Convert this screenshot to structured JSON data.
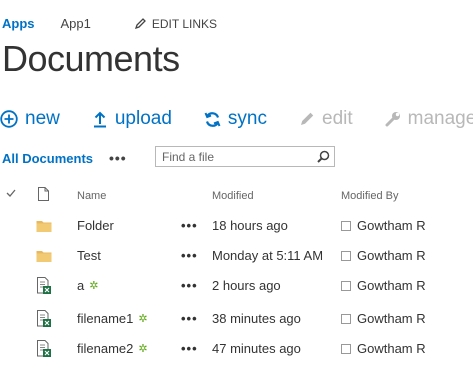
{
  "topnav": {
    "apps": "Apps",
    "app1": "App1",
    "edit_links": "EDIT LINKS"
  },
  "page_title": "Documents",
  "commands": {
    "new": "new",
    "upload": "upload",
    "sync": "sync",
    "edit": "edit",
    "manage": "manage"
  },
  "view": {
    "current_view": "All Documents",
    "more": "•••",
    "search_placeholder": "Find a file"
  },
  "columns": {
    "name": "Name",
    "modified": "Modified",
    "modified_by": "Modified By"
  },
  "rows": [
    {
      "type": "folder",
      "name": "Folder",
      "is_new": false,
      "menu": "•••",
      "modified": "18 hours ago",
      "modified_by": "Gowtham R"
    },
    {
      "type": "folder",
      "name": "Test",
      "is_new": false,
      "menu": "•••",
      "modified": "Monday at 5:11 AM",
      "modified_by": "Gowtham R"
    },
    {
      "type": "file",
      "name": "a",
      "is_new": true,
      "menu": "•••",
      "modified": "2 hours ago",
      "modified_by": "Gowtham R"
    },
    {
      "type": "file",
      "name": "filename1",
      "is_new": true,
      "menu": "•••",
      "modified": "38 minutes ago",
      "modified_by": "Gowtham R"
    },
    {
      "type": "file",
      "name": "filename2",
      "is_new": true,
      "menu": "•••",
      "modified": "47 minutes ago",
      "modified_by": "Gowtham R"
    }
  ],
  "colors": {
    "accent": "#0072c6",
    "disabled": "#b8b8b8",
    "folder": "#e8b95c",
    "new_badge": "#60a917",
    "file_icon": "#1e7145"
  }
}
